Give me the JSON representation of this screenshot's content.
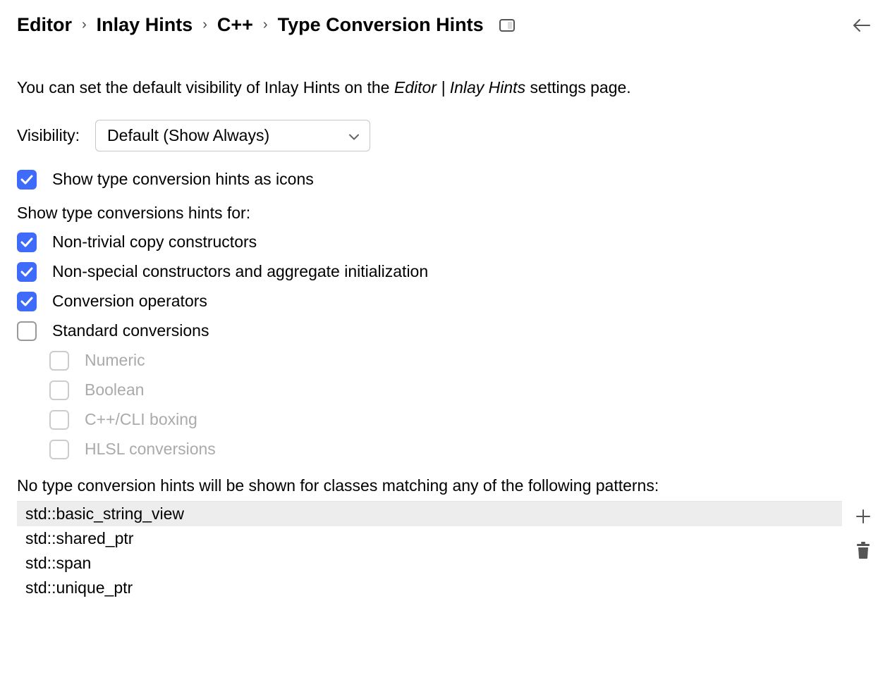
{
  "breadcrumb": {
    "items": [
      "Editor",
      "Inlay Hints",
      "C++",
      "Type Conversion Hints"
    ]
  },
  "intro": {
    "prefix": "You can set the default visibility of Inlay Hints on the ",
    "em": "Editor | Inlay Hints",
    "suffix": " settings page."
  },
  "visibility": {
    "label": "Visibility:",
    "selected": "Default (Show Always)"
  },
  "options": {
    "showAsIcons": {
      "label": "Show type conversion hints as icons",
      "checked": true
    },
    "sectionLabel": "Show type conversions hints for:",
    "nonTrivialCopy": {
      "label": "Non-trivial copy constructors",
      "checked": true
    },
    "nonSpecialCtors": {
      "label": "Non-special constructors and aggregate initialization",
      "checked": true
    },
    "conversionOps": {
      "label": "Conversion operators",
      "checked": true
    },
    "standardConv": {
      "label": "Standard conversions",
      "checked": false
    },
    "sub": {
      "numeric": {
        "label": "Numeric",
        "checked": false,
        "disabled": true
      },
      "boolean": {
        "label": "Boolean",
        "checked": false,
        "disabled": true
      },
      "cliBoxing": {
        "label": "C++/CLI boxing",
        "checked": false,
        "disabled": true
      },
      "hlsl": {
        "label": "HLSL conversions",
        "checked": false,
        "disabled": true
      }
    }
  },
  "patterns": {
    "label": "No type conversion hints will be shown for classes matching any of the following patterns:",
    "items": [
      "std::basic_string_view",
      "std::shared_ptr",
      "std::span",
      "std::unique_ptr"
    ],
    "selectedIndex": 0
  }
}
